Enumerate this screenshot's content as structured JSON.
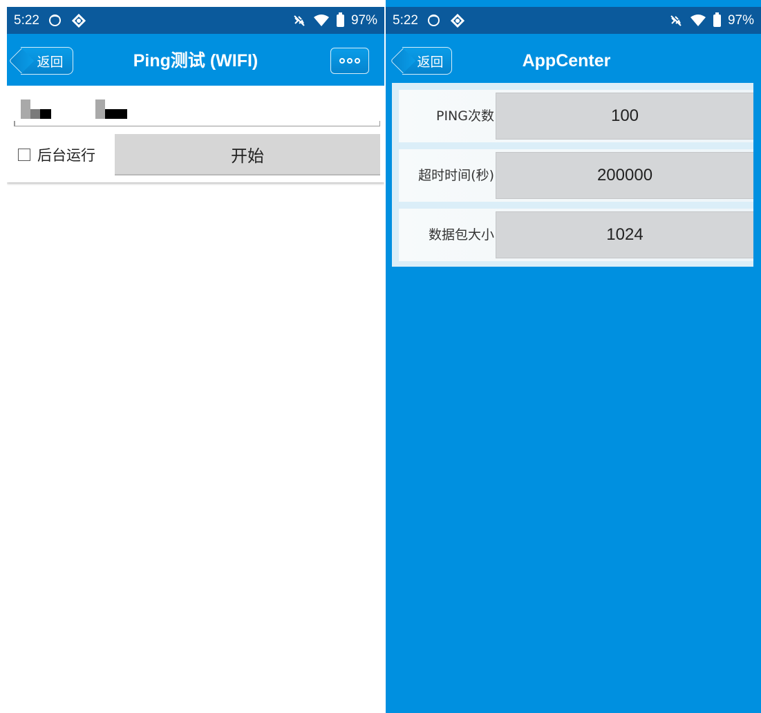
{
  "left": {
    "status": {
      "time": "5:22",
      "battery": "97%"
    },
    "nav": {
      "back_label": "返回",
      "title": "Ping测试 (WIFI)"
    },
    "host_input": {
      "value": ""
    },
    "background_checkbox": {
      "label": "后台运行",
      "checked": false
    },
    "start_button": {
      "label": "开始"
    }
  },
  "right": {
    "status": {
      "time": "5:22",
      "battery": "97%"
    },
    "nav": {
      "back_label": "返回",
      "title": "AppCenter"
    },
    "settings": [
      {
        "label": "PING次数",
        "value": "100"
      },
      {
        "label": "超时时间(秒)",
        "value": "200000"
      },
      {
        "label": "数据包大小",
        "value": "1024"
      }
    ]
  },
  "colors": {
    "status_bar": "#0b5a9c",
    "nav_bar": "#0090e0",
    "button_gray": "#d6d6d6"
  }
}
